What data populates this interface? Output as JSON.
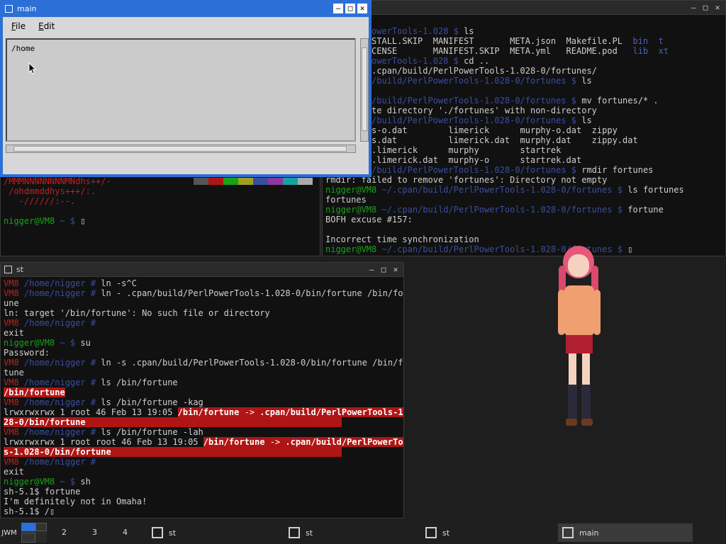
{
  "top_right_term": {
    "title": "",
    "lines": [
      [
        [
          "dim",
          "rtunes/"
        ]
      ],
      [
        [
          "r",
          "8"
        ],
        [
          "b",
          " ~/PerlPowerTools-1.028 $ "
        ],
        [
          "",
          "ls"
        ]
      ],
      [
        [
          "",
          "NG.md  INSTALL.SKIP  MANIFEST       META.json  Makefile.PL  "
        ],
        [
          "blue2",
          "bin"
        ],
        [
          "",
          "  "
        ],
        [
          "blue2",
          "t"
        ]
      ],
      [
        [
          "",
          "       LICENSE       MANIFEST.SKIP  META.yml   README.pod   "
        ],
        [
          "blue2",
          "lib"
        ],
        [
          "",
          "  "
        ],
        [
          "blue2",
          "xt"
        ]
      ],
      [
        [
          "r",
          "8"
        ],
        [
          "b",
          " ~/PerlPowerTools-1.028 $ "
        ],
        [
          "",
          "cd .."
        ]
      ],
      [
        [
          "r",
          "8"
        ],
        [
          "b",
          " ~ $ "
        ],
        [
          "",
          "cd .cpan/build/PerlPowerTools-1.028-0/fortunes/"
        ]
      ],
      [
        [
          "r",
          "8"
        ],
        [
          "b",
          " ~/.cpan/build/PerlPowerTools-1.028-0/fortunes $ "
        ],
        [
          "",
          "ls"
        ]
      ],
      [
        [
          "",
          ""
        ]
      ],
      [
        [
          "r",
          "8"
        ],
        [
          "b",
          " ~/.cpan/build/PerlPowerTools-1.028-0/fortunes $ "
        ],
        [
          "",
          "mv fortunes/* ."
        ]
      ],
      [
        [
          "",
          ": overwrite directory './fortunes' with non-directory"
        ]
      ],
      [
        [
          "r",
          "8"
        ],
        [
          "b",
          " ~/.cpan/build/PerlPowerTools-1.028-0/fortunes $ "
        ],
        [
          "",
          "ls"
        ]
      ],
      [
        [
          "",
          "  fortunes-o.dat        limerick      murphy-o.dat  zippy"
        ]
      ],
      [
        [
          "",
          "  fortunes.dat          limerick.dat  murphy.dat    zippy.dat"
        ]
      ],
      [
        [
          "",
          "  gerrold.limerick      murphy        startrek"
        ]
      ],
      [
        [
          "",
          "  gerrold.limerick.dat  murphy-o      startrek.dat"
        ]
      ],
      [
        [
          "r",
          "8"
        ],
        [
          "b",
          " ~/.cpan/build/PerlPowerTools-1.028-0/fortunes $ "
        ],
        [
          "",
          "rmdir fortunes"
        ]
      ],
      [
        [
          "",
          "rmdir: failed to remove 'fortunes': Directory not empty"
        ]
      ],
      [
        [
          "g",
          "nigger@VM8"
        ],
        [
          "b",
          " ~/.cpan/build/PerlPowerTools-1.028-0/fortunes $ "
        ],
        [
          "",
          "ls fortunes"
        ]
      ],
      [
        [
          "",
          "fortunes"
        ]
      ],
      [
        [
          "g",
          "nigger@VM8"
        ],
        [
          "b",
          " ~/.cpan/build/PerlPowerTools-1.028-0/fortunes $ "
        ],
        [
          "",
          "fortune"
        ]
      ],
      [
        [
          "",
          "BOFH excuse #157:"
        ]
      ],
      [
        [
          "",
          ""
        ]
      ],
      [
        [
          "",
          "Incorrect time synchronization"
        ]
      ],
      [
        [
          "g",
          "nigger@VM8"
        ],
        [
          "b",
          " ~/.cpan/build/PerlPowerTools-1.028-0/fortunes $ "
        ],
        [
          "",
          "▯"
        ]
      ]
    ]
  },
  "top_left_term": {
    "lines": [
      [
        [
          "r",
          "/MMMNNNNNNNNMNdhs++/-"
        ]
      ],
      [
        [
          "r",
          " /ohdmmddhys+++/:."
        ]
      ],
      [
        [
          "r",
          "   -//////:--."
        ]
      ],
      [
        [
          "",
          ""
        ]
      ],
      [
        [
          "g",
          "nigger@VM8"
        ],
        [
          "b",
          " ~ $ "
        ],
        [
          "",
          "▯"
        ]
      ]
    ]
  },
  "bottom_term": {
    "title": "st",
    "lines": [
      [
        [
          "r",
          "VM8"
        ],
        [
          "b",
          " /home/nigger # "
        ],
        [
          "",
          "ln -s^C"
        ]
      ],
      [
        [
          "r",
          "VM8"
        ],
        [
          "b",
          " /home/nigger # "
        ],
        [
          "",
          "ln - .cpan/build/PerlPowerTools-1.028-0/bin/fortune /bin/fort"
        ]
      ],
      [
        [
          "",
          "une"
        ]
      ],
      [
        [
          "",
          "ln: target '/bin/fortune': No such file or directory"
        ]
      ],
      [
        [
          "r",
          "VM8"
        ],
        [
          "b",
          " /home/nigger # "
        ]
      ],
      [
        [
          "",
          "exit"
        ]
      ],
      [
        [
          "g",
          "nigger@VM8"
        ],
        [
          "b",
          " ~ $ "
        ],
        [
          "",
          "su"
        ]
      ],
      [
        [
          "",
          "Password:"
        ]
      ],
      [
        [
          "r",
          "VM8"
        ],
        [
          "b",
          " /home/nigger # "
        ],
        [
          "",
          "ln -s .cpan/build/PerlPowerTools-1.028-0/bin/fortune /bin/for"
        ]
      ],
      [
        [
          "",
          "tune"
        ]
      ],
      [
        [
          "r",
          "VM8"
        ],
        [
          "b",
          " /home/nigger # "
        ],
        [
          "",
          "ls /bin/fortune"
        ]
      ],
      [
        [
          "hlb",
          "/bin/fortune"
        ]
      ],
      [
        [
          "r",
          "VM8"
        ],
        [
          "b",
          " /home/nigger # "
        ],
        [
          "",
          "ls /bin/fortune -kag"
        ]
      ],
      [
        [
          "",
          "lrwxrwxrwx 1 root 46 Feb 13 19:05 "
        ],
        [
          "hlb",
          "/bin/fortune"
        ],
        [
          "hl",
          " -> "
        ],
        [
          "hlb",
          ".cpan/build/PerlPowerTools-1.0"
        ]
      ],
      [
        [
          "hlb",
          "28-0/bin/fortune                                                  "
        ]
      ],
      [
        [
          "r",
          "VM8"
        ],
        [
          "b",
          " /home/nigger # "
        ],
        [
          "",
          "ls /bin/fortune -lah"
        ]
      ],
      [
        [
          "",
          "lrwxrwxrwx 1 root root 46 Feb 13 19:05 "
        ],
        [
          "hlb",
          "/bin/fortune"
        ],
        [
          "hl",
          " -> "
        ],
        [
          "hlb",
          ".cpan/build/PerlPowerTool"
        ]
      ],
      [
        [
          "hlb",
          "s-1.028-0/bin/fortune                                             "
        ]
      ],
      [
        [
          "r",
          "VM8"
        ],
        [
          "b",
          " /home/nigger # "
        ]
      ],
      [
        [
          "",
          "exit"
        ]
      ],
      [
        [
          "g",
          "nigger@VM8"
        ],
        [
          "b",
          " ~ $ "
        ],
        [
          "",
          "sh"
        ]
      ],
      [
        [
          "",
          "sh-5.1$ fortune"
        ]
      ],
      [
        [
          "",
          "I'm definitely not in Omaha!"
        ]
      ],
      [
        [
          "",
          "sh-5.1$ /▯"
        ]
      ]
    ]
  },
  "main_window": {
    "title": "main",
    "menu": [
      {
        "key": "F",
        "rest": "ile"
      },
      {
        "key": "E",
        "rest": "dit"
      }
    ],
    "text": "/home"
  },
  "palette": [
    "#555555",
    "#b01515",
    "#17a31a",
    "#a0a020",
    "#3a4ea0",
    "#8a3a9a",
    "#1aa0a0",
    "#aaaaaa"
  ],
  "taskbar": {
    "logo": "JWM",
    "pager": [
      "2",
      "3",
      "4"
    ],
    "tasks": [
      {
        "label": "st",
        "active": false
      },
      {
        "label": "st",
        "active": false
      },
      {
        "label": "st",
        "active": false
      },
      {
        "label": "main",
        "active": true
      }
    ]
  }
}
